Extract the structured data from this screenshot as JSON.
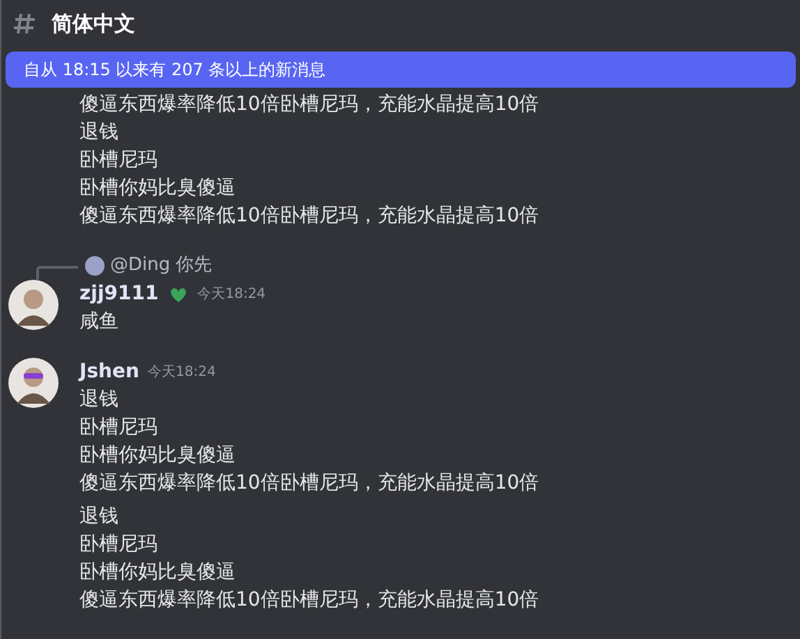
{
  "channel": {
    "name": "简体中文"
  },
  "banner": {
    "text": "自从 18:15 以来有 207 条以上的新消息"
  },
  "groups": [
    {
      "kind": "continuation",
      "blocks": [
        [
          "傻逼东西爆率降低10倍卧槽尼玛，充能水晶提高10倍",
          "退钱",
          "卧槽尼玛",
          "卧槽你妈比臭傻逼",
          "傻逼东西爆率降低10倍卧槽尼玛，充能水晶提高10倍"
        ]
      ]
    },
    {
      "kind": "message",
      "reply": {
        "author": "@Ding",
        "text": "你先"
      },
      "author": "zjj9111",
      "has_badge": true,
      "time": "今天18:24",
      "blocks": [
        [
          "咸鱼"
        ]
      ]
    },
    {
      "kind": "message",
      "author": "Jshen",
      "has_badge": false,
      "time": "今天18:24",
      "blocks": [
        [
          "退钱",
          "卧槽尼玛",
          "卧槽你妈比臭傻逼",
          "傻逼东西爆率降低10倍卧槽尼玛，充能水晶提高10倍"
        ],
        [
          "退钱",
          "卧槽尼玛",
          "卧槽你妈比臭傻逼",
          "傻逼东西爆率降低10倍卧槽尼玛，充能水晶提高10倍"
        ]
      ]
    }
  ]
}
